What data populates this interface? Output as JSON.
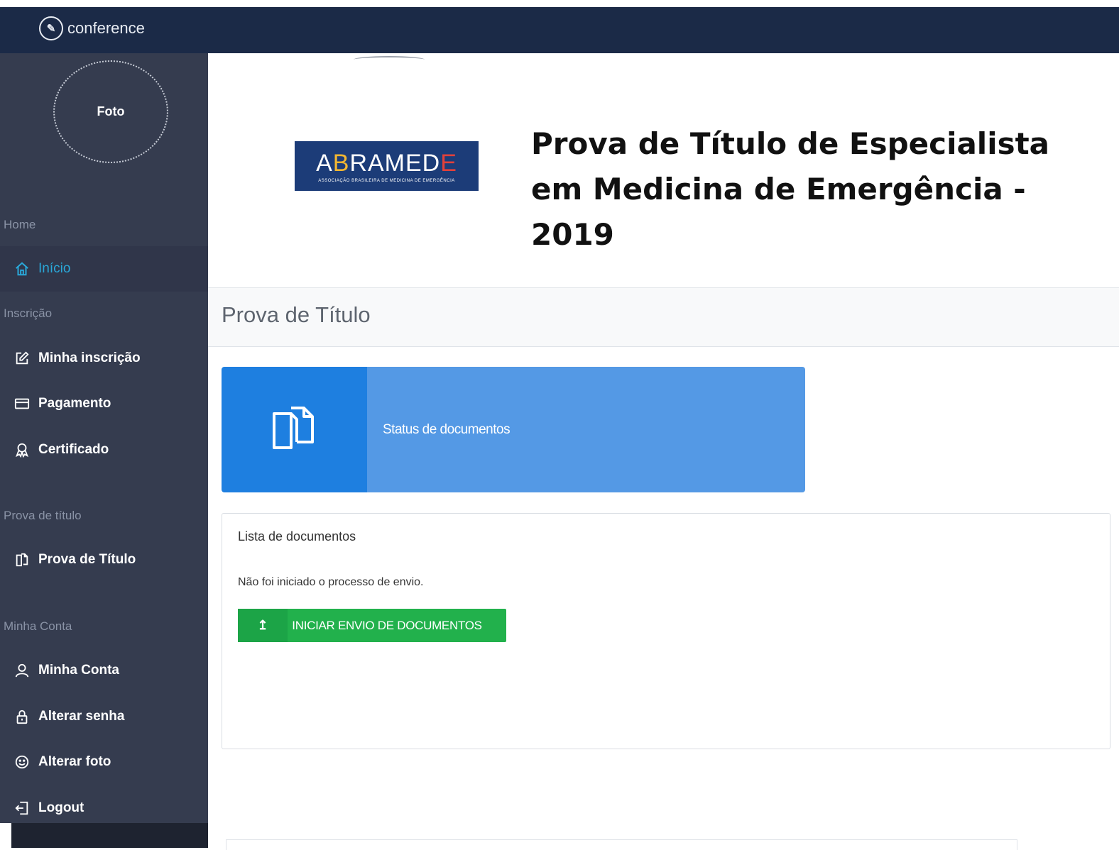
{
  "app": {
    "brand_name": "conference"
  },
  "sidebar": {
    "photo_label": "Foto",
    "sections": [
      {
        "label": "Home"
      },
      {
        "label": "Inscrição"
      },
      {
        "label": "Prova de título"
      },
      {
        "label": "Minha Conta"
      }
    ],
    "items": [
      {
        "label": "Início",
        "icon": "home-icon",
        "active": true
      },
      {
        "label": "Minha inscrição",
        "icon": "edit-icon"
      },
      {
        "label": "Pagamento",
        "icon": "credit-card-icon"
      },
      {
        "label": "Certificado",
        "icon": "award-icon"
      },
      {
        "label": "Prova de Título",
        "icon": "documents-icon"
      },
      {
        "label": "Minha Conta",
        "icon": "user-icon"
      },
      {
        "label": "Alterar senha",
        "icon": "lock-icon"
      },
      {
        "label": "Alterar foto",
        "icon": "smile-icon"
      },
      {
        "label": "Logout",
        "icon": "logout-icon"
      }
    ]
  },
  "banner": {
    "logo_text": "ABRAMEDE",
    "logo_subtitle": "ASSOCIAÇÃO BRASILEIRA DE MEDICINA DE EMERGÊNCIA",
    "title": "Prova de Título de Especialista em Medicina de Emergência - 2019"
  },
  "page": {
    "title": "Prova de Título",
    "status_card_label": "Status de documentos",
    "documents_panel": {
      "title": "Lista de documentos",
      "message": "Não foi iniciado o processo de envio.",
      "button_label": "INICIAR ENVIO DE DOCUMENTOS"
    }
  },
  "colors": {
    "topbar": "#1b2a47",
    "sidebar": "#353c4f",
    "active_link": "#2aa8d9",
    "status_card_dark": "#1e7fe0",
    "status_card_light": "#5499e5",
    "button_green": "#22b14c"
  }
}
